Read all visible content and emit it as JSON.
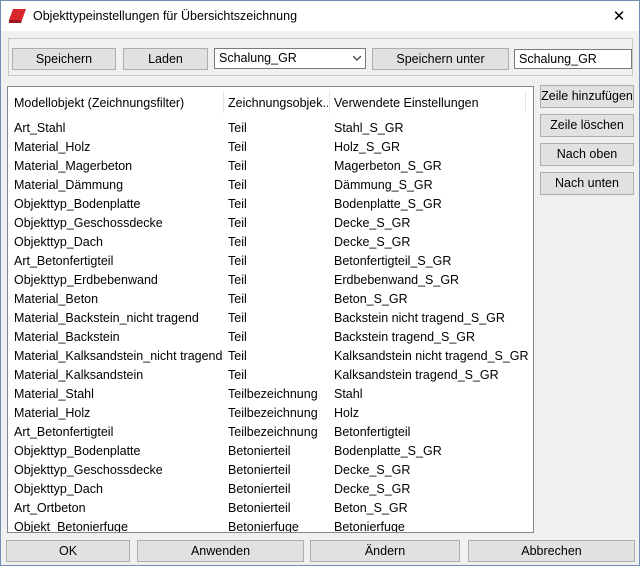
{
  "window": {
    "title": "Objekttypeinstellungen für Übersichtszeichnung",
    "close_glyph": "✕",
    "brand_color": "#d7262e"
  },
  "toolbar": {
    "save_label": "Speichern",
    "load_label": "Laden",
    "preset_selected": "Schalung_GR",
    "save_as_label": "Speichern unter",
    "save_as_name": "Schalung_GR"
  },
  "table": {
    "headers": [
      "Modellobjekt (Zeichnungsfilter)",
      "Zeichnungsobjek...",
      "Verwendete Einstellungen"
    ],
    "rows": [
      [
        "Art_Stahl",
        "Teil",
        "Stahl_S_GR"
      ],
      [
        "Material_Holz",
        "Teil",
        "Holz_S_GR"
      ],
      [
        "Material_Magerbeton",
        "Teil",
        "Magerbeton_S_GR"
      ],
      [
        "Material_Dämmung",
        "Teil",
        "Dämmung_S_GR"
      ],
      [
        "Objekttyp_Bodenplatte",
        "Teil",
        "Bodenplatte_S_GR"
      ],
      [
        "Objekttyp_Geschossdecke",
        "Teil",
        "Decke_S_GR"
      ],
      [
        "Objekttyp_Dach",
        "Teil",
        "Decke_S_GR"
      ],
      [
        "Art_Betonfertigteil",
        "Teil",
        "Betonfertigteil_S_GR"
      ],
      [
        "Objekttyp_Erdbebenwand",
        "Teil",
        "Erdbebenwand_S_GR"
      ],
      [
        "Material_Beton",
        "Teil",
        "Beton_S_GR"
      ],
      [
        "Material_Backstein_nicht tragend",
        "Teil",
        "Backstein nicht tragend_S_GR"
      ],
      [
        "Material_Backstein",
        "Teil",
        "Backstein tragend_S_GR"
      ],
      [
        "Material_Kalksandstein_nicht tragend",
        "Teil",
        "Kalksandstein nicht tragend_S_GR"
      ],
      [
        "Material_Kalksandstein",
        "Teil",
        "Kalksandstein tragend_S_GR"
      ],
      [
        "Material_Stahl",
        "Teilbezeichnung",
        "Stahl"
      ],
      [
        "Material_Holz",
        "Teilbezeichnung",
        "Holz"
      ],
      [
        "Art_Betonfertigteil",
        "Teilbezeichnung",
        "Betonfertigteil"
      ],
      [
        "Objekttyp_Bodenplatte",
        "Betonierteil",
        "Bodenplatte_S_GR"
      ],
      [
        "Objekttyp_Geschossdecke",
        "Betonierteil",
        "Decke_S_GR"
      ],
      [
        "Objekttyp_Dach",
        "Betonierteil",
        "Decke_S_GR"
      ],
      [
        "Art_Ortbeton",
        "Betonierteil",
        "Beton_S_GR"
      ],
      [
        "Objekt_Betonierfuge",
        "Betonierfuge",
        "Betonierfuge"
      ]
    ]
  },
  "side_buttons": {
    "add_row": "Zeile hinzufügen",
    "delete_row": "Zeile löschen",
    "move_up": "Nach oben",
    "move_down": "Nach unten"
  },
  "footer": {
    "ok": "OK",
    "apply": "Anwenden",
    "modify": "Ändern",
    "cancel": "Abbrechen"
  }
}
